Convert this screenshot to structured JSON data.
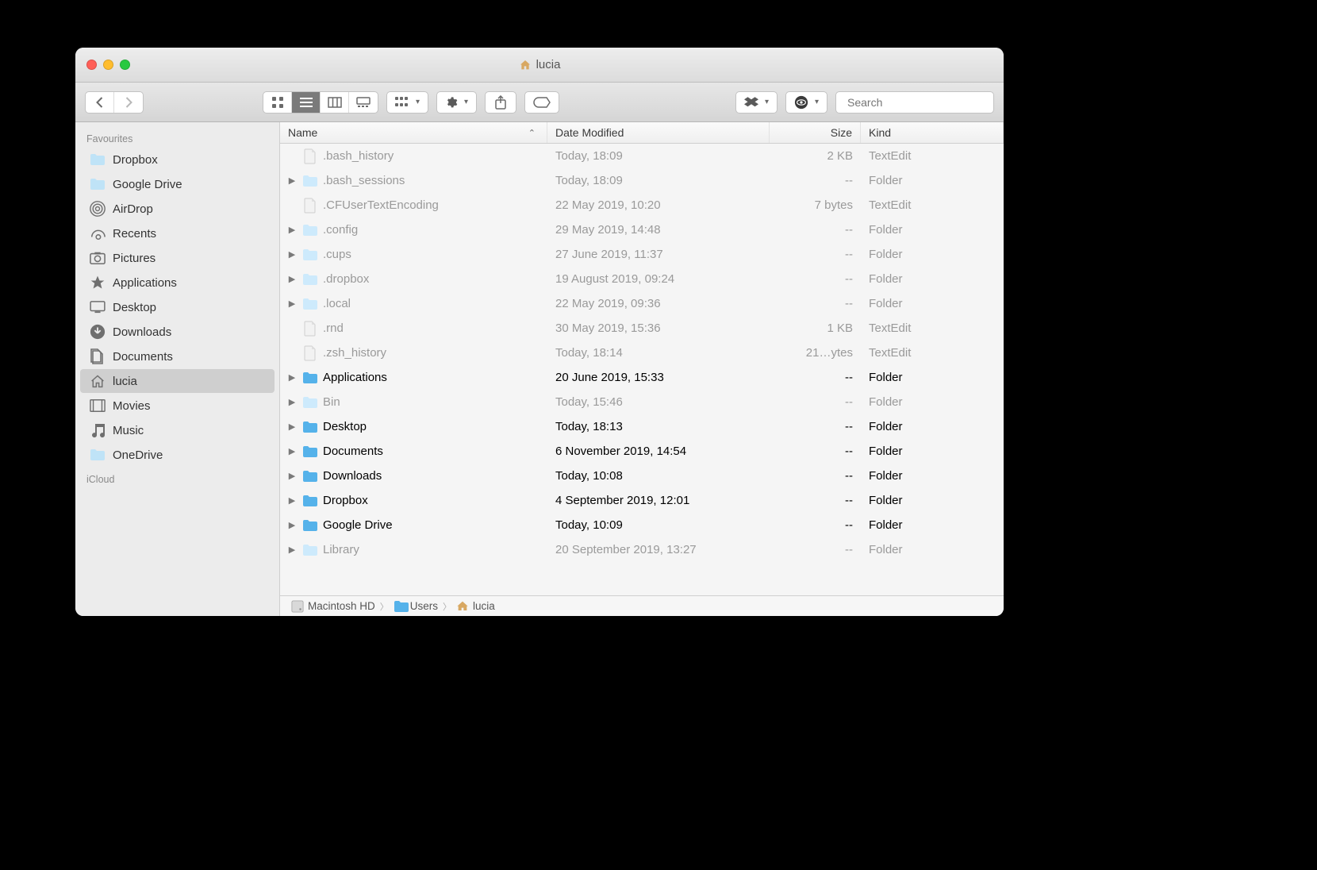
{
  "window": {
    "title": "lucia"
  },
  "toolbar": {
    "search_placeholder": "Search"
  },
  "sidebar": {
    "sections": [
      {
        "label": "Favourites",
        "items": [
          {
            "icon": "folder",
            "label": "Dropbox"
          },
          {
            "icon": "folder",
            "label": "Google Drive"
          },
          {
            "icon": "airdrop",
            "label": "AirDrop"
          },
          {
            "icon": "recents",
            "label": "Recents"
          },
          {
            "icon": "pictures",
            "label": "Pictures"
          },
          {
            "icon": "apps",
            "label": "Applications"
          },
          {
            "icon": "desktop",
            "label": "Desktop"
          },
          {
            "icon": "downloads",
            "label": "Downloads"
          },
          {
            "icon": "documents",
            "label": "Documents"
          },
          {
            "icon": "home",
            "label": "lucia",
            "selected": true
          },
          {
            "icon": "movies",
            "label": "Movies"
          },
          {
            "icon": "music",
            "label": "Music"
          },
          {
            "icon": "folder",
            "label": "OneDrive"
          }
        ]
      },
      {
        "label": "iCloud",
        "items": []
      }
    ]
  },
  "columns": {
    "name": "Name",
    "date": "Date Modified",
    "size": "Size",
    "kind": "Kind"
  },
  "files": [
    {
      "kindico": "doc",
      "name": ".bash_history",
      "date": "Today, 18:09",
      "size": "2 KB",
      "kind": "TextEdit",
      "dim": true,
      "folder": false
    },
    {
      "kindico": "folder",
      "name": ".bash_sessions",
      "date": "Today, 18:09",
      "size": "--",
      "kind": "Folder",
      "dim": true,
      "folder": true
    },
    {
      "kindico": "doc",
      "name": ".CFUserTextEncoding",
      "date": "22 May 2019, 10:20",
      "size": "7 bytes",
      "kind": "TextEdit",
      "dim": true,
      "folder": false
    },
    {
      "kindico": "folder",
      "name": ".config",
      "date": "29 May 2019, 14:48",
      "size": "--",
      "kind": "Folder",
      "dim": true,
      "folder": true
    },
    {
      "kindico": "folder",
      "name": ".cups",
      "date": "27 June 2019, 11:37",
      "size": "--",
      "kind": "Folder",
      "dim": true,
      "folder": true
    },
    {
      "kindico": "folder",
      "name": ".dropbox",
      "date": "19 August 2019, 09:24",
      "size": "--",
      "kind": "Folder",
      "dim": true,
      "folder": true
    },
    {
      "kindico": "folder",
      "name": ".local",
      "date": "22 May 2019, 09:36",
      "size": "--",
      "kind": "Folder",
      "dim": true,
      "folder": true
    },
    {
      "kindico": "doc",
      "name": ".rnd",
      "date": "30 May 2019, 15:36",
      "size": "1 KB",
      "kind": "TextEdit",
      "dim": true,
      "folder": false
    },
    {
      "kindico": "doc",
      "name": ".zsh_history",
      "date": "Today, 18:14",
      "size": "21…ytes",
      "kind": "TextEdit",
      "dim": true,
      "folder": false
    },
    {
      "kindico": "folder-apps",
      "name": "Applications",
      "date": "20 June 2019, 15:33",
      "size": "--",
      "kind": "Folder",
      "dim": false,
      "folder": true
    },
    {
      "kindico": "folder",
      "name": "Bin",
      "date": "Today, 15:46",
      "size": "--",
      "kind": "Folder",
      "dim": true,
      "folder": true
    },
    {
      "kindico": "folder-sys",
      "name": "Desktop",
      "date": "Today, 18:13",
      "size": "--",
      "kind": "Folder",
      "dim": false,
      "folder": true
    },
    {
      "kindico": "folder-sys",
      "name": "Documents",
      "date": "6 November 2019, 14:54",
      "size": "--",
      "kind": "Folder",
      "dim": false,
      "folder": true
    },
    {
      "kindico": "folder-sys",
      "name": "Downloads",
      "date": "Today, 10:08",
      "size": "--",
      "kind": "Folder",
      "dim": false,
      "folder": true
    },
    {
      "kindico": "folder-sys",
      "name": "Dropbox",
      "date": "4 September 2019, 12:01",
      "size": "--",
      "kind": "Folder",
      "dim": false,
      "folder": true
    },
    {
      "kindico": "folder-sys",
      "name": "Google Drive",
      "date": "Today, 10:09",
      "size": "--",
      "kind": "Folder",
      "dim": false,
      "folder": true
    },
    {
      "kindico": "folder",
      "name": "Library",
      "date": "20 September 2019, 13:27",
      "size": "--",
      "kind": "Folder",
      "dim": true,
      "folder": true
    }
  ],
  "pathbar": [
    {
      "icon": "disk",
      "label": "Macintosh HD"
    },
    {
      "icon": "folder-sys",
      "label": "Users"
    },
    {
      "icon": "home",
      "label": "lucia"
    }
  ]
}
